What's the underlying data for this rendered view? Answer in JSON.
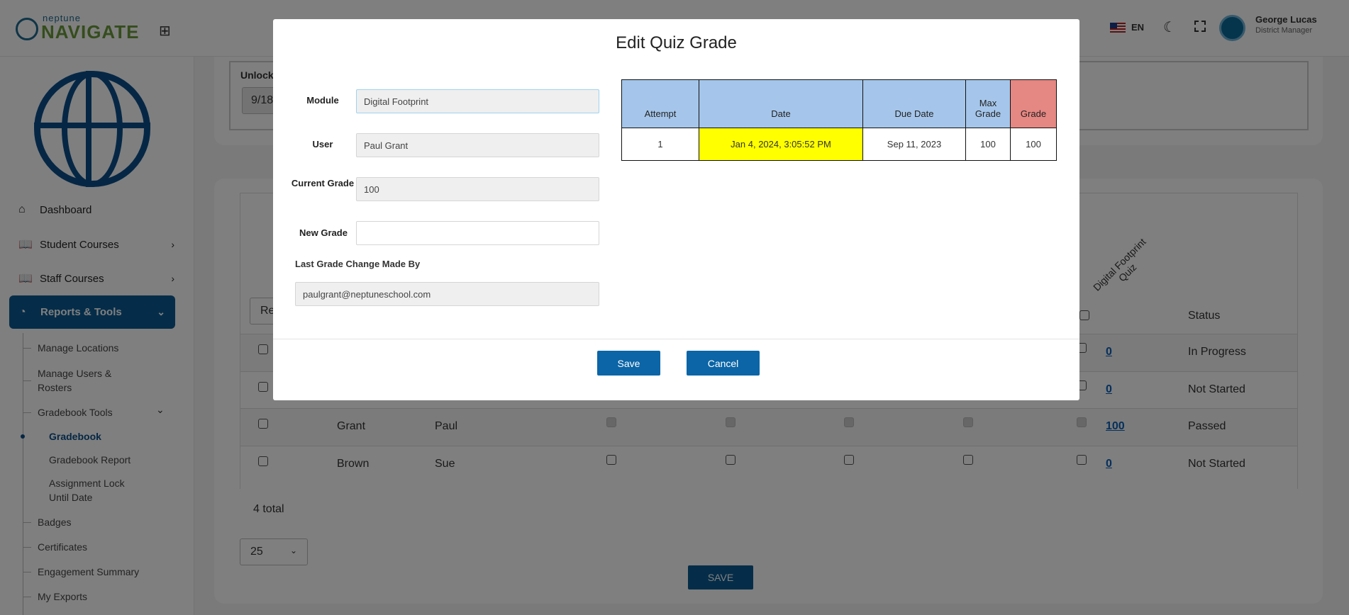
{
  "header": {
    "brand_small": "neptune",
    "brand_main": "NAVIGATE",
    "language": "EN",
    "user_name": "George Lucas",
    "user_role": "District Manager"
  },
  "sidebar": {
    "items": [
      {
        "label": "Dashboard",
        "icon": "home-icon"
      },
      {
        "label": "Student Courses",
        "icon": "book-icon"
      },
      {
        "label": "Staff Courses",
        "icon": "book-icon"
      },
      {
        "label": "Reports & Tools",
        "icon": "pie-chart-icon"
      }
    ],
    "sub_items": [
      "Manage Locations",
      "Manage Users & Rosters",
      "Gradebook Tools",
      "Gradebook",
      "Gradebook Report",
      "Assignment Lock Until Date",
      "Badges",
      "Certificates",
      "Engagement Summary",
      "My Exports"
    ]
  },
  "main": {
    "unlock_label": "Unlock",
    "unlock_value": "9/18",
    "reset_button": "Re",
    "column_header": "Digital Footprint Quiz",
    "status_header": "Status",
    "rows": [
      {
        "last": "",
        "first": "",
        "grade": "0",
        "status": "In Progress"
      },
      {
        "last": "",
        "first": "",
        "grade": "0",
        "status": "Not Started"
      },
      {
        "last": "Grant",
        "first": "Paul",
        "grade": "100",
        "status": "Passed"
      },
      {
        "last": "Brown",
        "first": "Sue",
        "grade": "0",
        "status": "Not Started"
      }
    ],
    "total": "4 total",
    "page_size": "25",
    "save_button": "SAVE"
  },
  "modal": {
    "title": "Edit Quiz Grade",
    "module_label": "Module",
    "module_value": "Digital Footprint",
    "user_label": "User",
    "user_value": "Paul Grant",
    "current_grade_label": "Current Grade",
    "current_grade_value": "100",
    "new_grade_label": "New Grade",
    "new_grade_value": "",
    "last_change_label": "Last Grade Change Made By",
    "last_change_value": "paulgrant@neptuneschool.com",
    "table": {
      "headers": [
        "Attempt",
        "Date",
        "Due Date",
        "Max Grade",
        "Grade"
      ],
      "rows": [
        [
          "1",
          "Jan 4, 2024, 3:05:52 PM",
          "Sep 11, 2023",
          "100",
          "100"
        ]
      ]
    },
    "save_button": "Save",
    "cancel_button": "Cancel"
  },
  "colors": {
    "accent": "#0b65a6",
    "header_cell": "#a5c6ea",
    "grade_header": "#e58782",
    "date_highlight": "#ffff00"
  }
}
